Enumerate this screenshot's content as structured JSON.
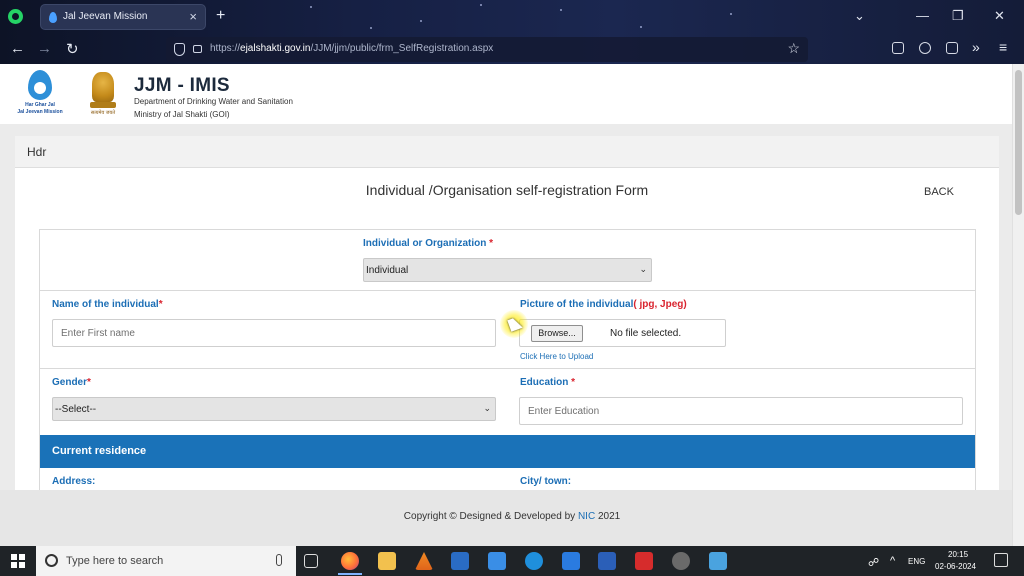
{
  "browser": {
    "tab_title": "Jal Jeevan Mission",
    "tab_close": "×",
    "new_tab": "+",
    "url_prefix": "https://",
    "url_domain": "ejalshakti.gov.in",
    "url_path": "/JJM/jjm/public/frm_SelfRegistration.aspx",
    "icons": [
      "whatsapp-icon",
      "back-icon",
      "forward-icon",
      "reload-icon",
      "shield-icon",
      "lock-icon",
      "bookmark-star-icon",
      "pocket-icon",
      "account-icon",
      "extensions-icon",
      "overflow-icon",
      "menu-icon"
    ]
  },
  "site": {
    "logo_caption": "Har Ghar Jal\nJal Jeevan Mission",
    "emblem_caption": "सत्यमेव जयते",
    "title": "JJM - IMIS",
    "subtitle_1": "Department of Drinking Water and Sanitation",
    "subtitle_2": "Ministry of Jal Shakti (GOI)"
  },
  "form": {
    "hdr": "Hdr",
    "title": "Individual /Organisation self-registration Form",
    "back_label": "BACK",
    "type_label": "Individual or Organization",
    "type_value": "Individual",
    "name_label": "Name of the individual",
    "name_placeholder": "Enter First name",
    "picture_label": "Picture of the individual",
    "picture_formats": "( jpg, Jpeg)",
    "browse_label": "Browse...",
    "file_status": "No file selected.",
    "upload_hint": "Click Here to Upload",
    "gender_label": "Gender",
    "gender_value": "--Select--",
    "education_label": "Education",
    "education_placeholder": "Enter Education",
    "residence_heading": "Current residence",
    "address_label": "Address:",
    "city_label": "City/ town:",
    "required_mark": "*"
  },
  "footer": {
    "text": "Copyright © Designed & Developed by",
    "org": "NIC",
    "year": "2021"
  },
  "taskbar": {
    "search_placeholder": "Type here to search",
    "language": "ENG",
    "time": "20:15",
    "date": "02-06-2024"
  }
}
